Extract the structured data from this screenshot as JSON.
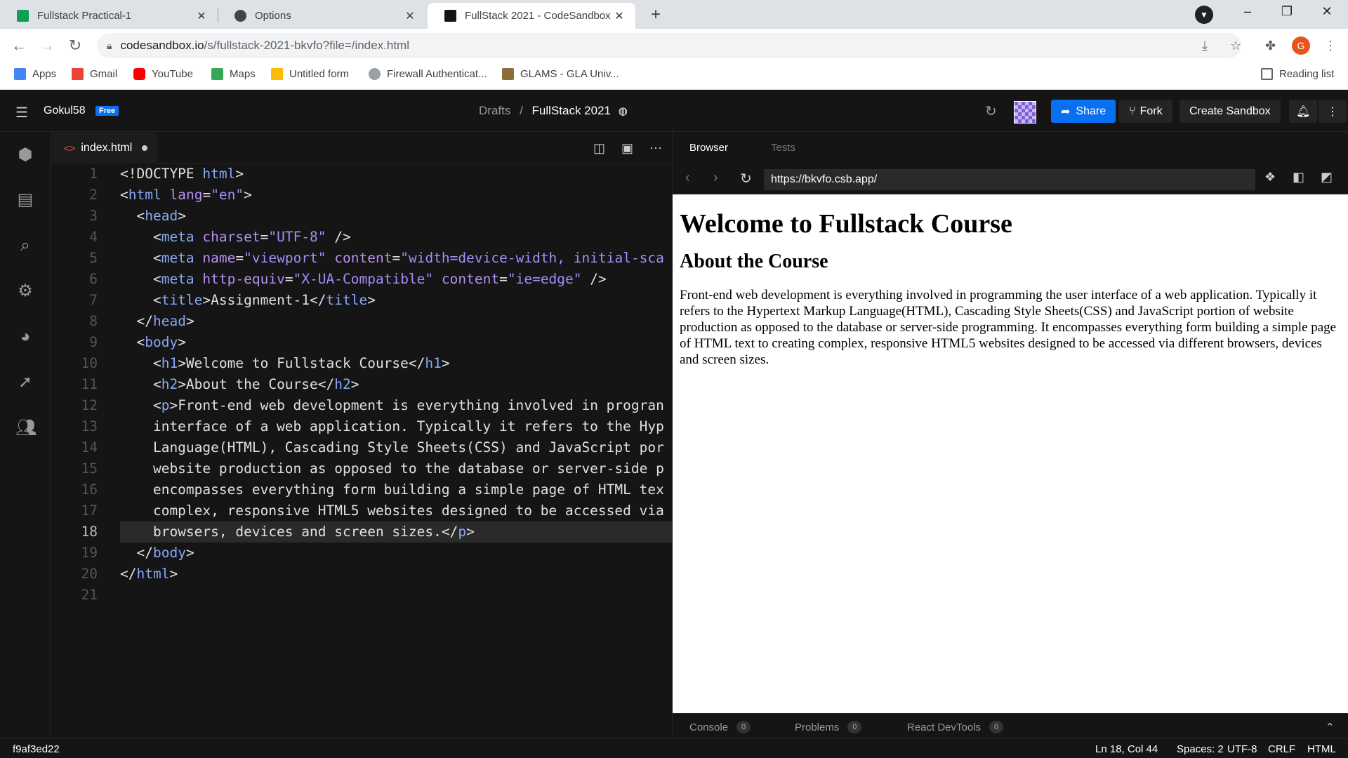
{
  "browser": {
    "tabs": [
      {
        "title": "Fullstack Practical-1",
        "fav_color": "#0f9d58"
      },
      {
        "title": "Options",
        "fav_color": "#444444"
      },
      {
        "title": "FullStack 2021 - CodeSandbox",
        "fav_color": "#151515"
      }
    ],
    "url_host": "codesandbox.io",
    "url_path": "/s/fullstack-2021-bkvfo?file=/index.html",
    "profile_initial": "G",
    "bookmarks": [
      {
        "label": "Apps",
        "color": "#4285f4"
      },
      {
        "label": "Gmail",
        "color": "#ea4335"
      },
      {
        "label": "YouTube",
        "color": "#ff0000"
      },
      {
        "label": "Maps",
        "color": "#34a853"
      },
      {
        "label": "Untitled form",
        "color": "#fbbc04"
      },
      {
        "label": "Firewall Authenticat...",
        "color": "#9aa0a6"
      },
      {
        "label": "GLAMS - GLA Univ...",
        "color": "#8d6e3b"
      }
    ],
    "reading_list": "Reading list"
  },
  "header": {
    "user": "Gokul58",
    "plan_badge": "Free",
    "crumb_parent": "Drafts",
    "crumb_sep": "/",
    "sandbox_name": "FullStack 2021",
    "share_label": "Share",
    "fork_label": "Fork",
    "create_label": "Create Sandbox"
  },
  "editor": {
    "tab_name": "index.html",
    "current_line": 18,
    "lines": [
      "1",
      "2",
      "3",
      "4",
      "5",
      "6",
      "7",
      "8",
      "9",
      "10",
      "11",
      "12",
      "13",
      "14",
      "15",
      "16",
      "17",
      "18",
      "19",
      "20",
      "21"
    ]
  },
  "preview": {
    "tab_browser": "Browser",
    "tab_tests": "Tests",
    "url": "https://bkvfo.csb.app/",
    "h1": "Welcome to Fullstack Course",
    "h2": "About the Course",
    "p": "Front-end web development is everything involved in programming the user interface of a web application. Typically it refers to the Hypertext Markup Language(HTML), Cascading Style Sheets(CSS) and JavaScript portion of website production as opposed to the database or server-side programming. It encompasses everything form building a simple page of HTML text to creating complex, responsive HTML5 websites designed to be accessed via different browsers, devices and screen sizes.",
    "bottom_tabs": [
      {
        "label": "Console",
        "count": "0"
      },
      {
        "label": "Problems",
        "count": "0"
      },
      {
        "label": "React DevTools",
        "count": "0"
      }
    ]
  },
  "status": {
    "commit": "f9af3ed22",
    "position": "Ln 18, Col 44",
    "spaces": "Spaces: 2",
    "encoding": "UTF-8",
    "eol": "CRLF",
    "language": "HTML"
  }
}
